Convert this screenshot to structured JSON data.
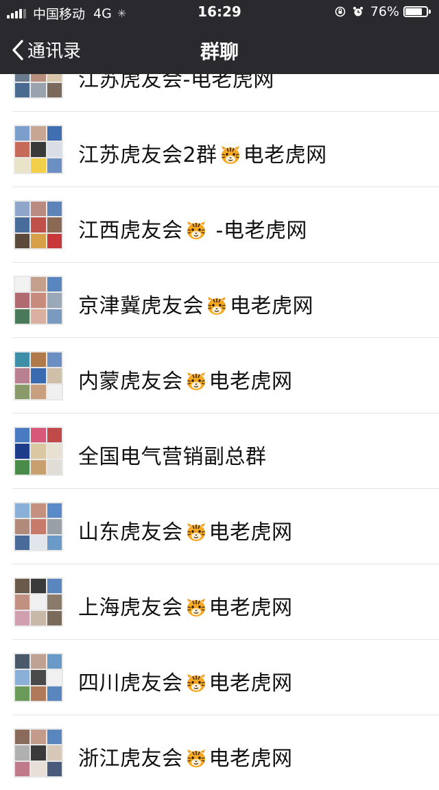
{
  "status": {
    "carrier": "中国移动",
    "network": "4G",
    "time": "16:29",
    "battery": "76%",
    "battery_level": 0.76
  },
  "navbar": {
    "back_label": "通讯录",
    "title": "群聊"
  },
  "groups": [
    {
      "pre": "江苏虎友会",
      "post": "-电老虎网",
      "tiger": false,
      "avatar": [
        "#8a8f99",
        "#c49b86",
        "#5b7aa8",
        "#6b7a8c",
        "#b98e7a",
        "#d9c6a8",
        "#4a6a90",
        "#9aa3ad",
        "#7b6a5c"
      ]
    },
    {
      "pre": "江苏虎友会2群",
      "post": "电老虎网",
      "tiger": true,
      "avatar": [
        "#7d9ecb",
        "#c8a694",
        "#3f6fb0",
        "#c66a5a",
        "#3a3a3a",
        "#d8dde6",
        "#e9e3c9",
        "#f2d04a",
        "#6b8fc2"
      ]
    },
    {
      "pre": "江西虎友会",
      "post": " -电老虎网",
      "tiger": true,
      "avatar": [
        "#8fa6c8",
        "#b88a80",
        "#5c84b8",
        "#4a6c9a",
        "#c0504a",
        "#8a6a55",
        "#5b4a3a",
        "#d9a04a",
        "#c8383a"
      ]
    },
    {
      "pre": "京津冀虎友会",
      "post": "电老虎网",
      "tiger": true,
      "avatar": [
        "#f2f2f2",
        "#c4a08c",
        "#5a86c0",
        "#b06a70",
        "#c88a7a",
        "#9aa8b8",
        "#4a7a5a",
        "#d9b0a0",
        "#7a9ac0"
      ]
    },
    {
      "pre": "内蒙虎友会",
      "post": "电老虎网",
      "tiger": true,
      "avatar": [
        "#3e8ea8",
        "#b07a4a",
        "#6b8fc2",
        "#b88090",
        "#3a6ab0",
        "#d0c0a8",
        "#8a9a6a",
        "#c8a080",
        "#f0f0f0"
      ]
    },
    {
      "pre": "全国电气营销副总群",
      "post": "",
      "tiger": false,
      "avatar": [
        "#4a7ac0",
        "#d8587a",
        "#c04a4a",
        "#1e3c8a",
        "#d9c8a0",
        "#e8e0d0",
        "#4a8a4a",
        "#c8a070",
        "#e0ddd6"
      ]
    },
    {
      "pre": "山东虎友会",
      "post": "电老虎网",
      "tiger": true,
      "avatar": [
        "#8ab0d8",
        "#c49080",
        "#5a8ac8",
        "#b08a7a",
        "#c87a6a",
        "#9aa0a8",
        "#4a6a9a",
        "#e0e6ec",
        "#6a9ac8"
      ]
    },
    {
      "pre": "上海虎友会",
      "post": "电老虎网",
      "tiger": true,
      "avatar": [
        "#6a5a4a",
        "#3a3a3a",
        "#5a86c0",
        "#c09080",
        "#f0f0f0",
        "#8a7a6a",
        "#d0a0b0",
        "#c8b8a8",
        "#7a6a5a"
      ]
    },
    {
      "pre": "四川虎友会",
      "post": "电老虎网",
      "tiger": true,
      "avatar": [
        "#4a5a6a",
        "#c0a090",
        "#6a9ac8",
        "#8ab0d8",
        "#4a4a4a",
        "#f0f0f0",
        "#6a9a5a",
        "#b07a5a",
        "#5a86c0"
      ]
    },
    {
      "pre": "浙江虎友会",
      "post": "电老虎网",
      "tiger": true,
      "avatar": [
        "#8a6a5a",
        "#c49a8a",
        "#5a86c0",
        "#b0b0b0",
        "#3a3a3a",
        "#d8c8b8",
        "#c07a8a",
        "#e8e0d8",
        "#4a5a7a"
      ]
    }
  ]
}
